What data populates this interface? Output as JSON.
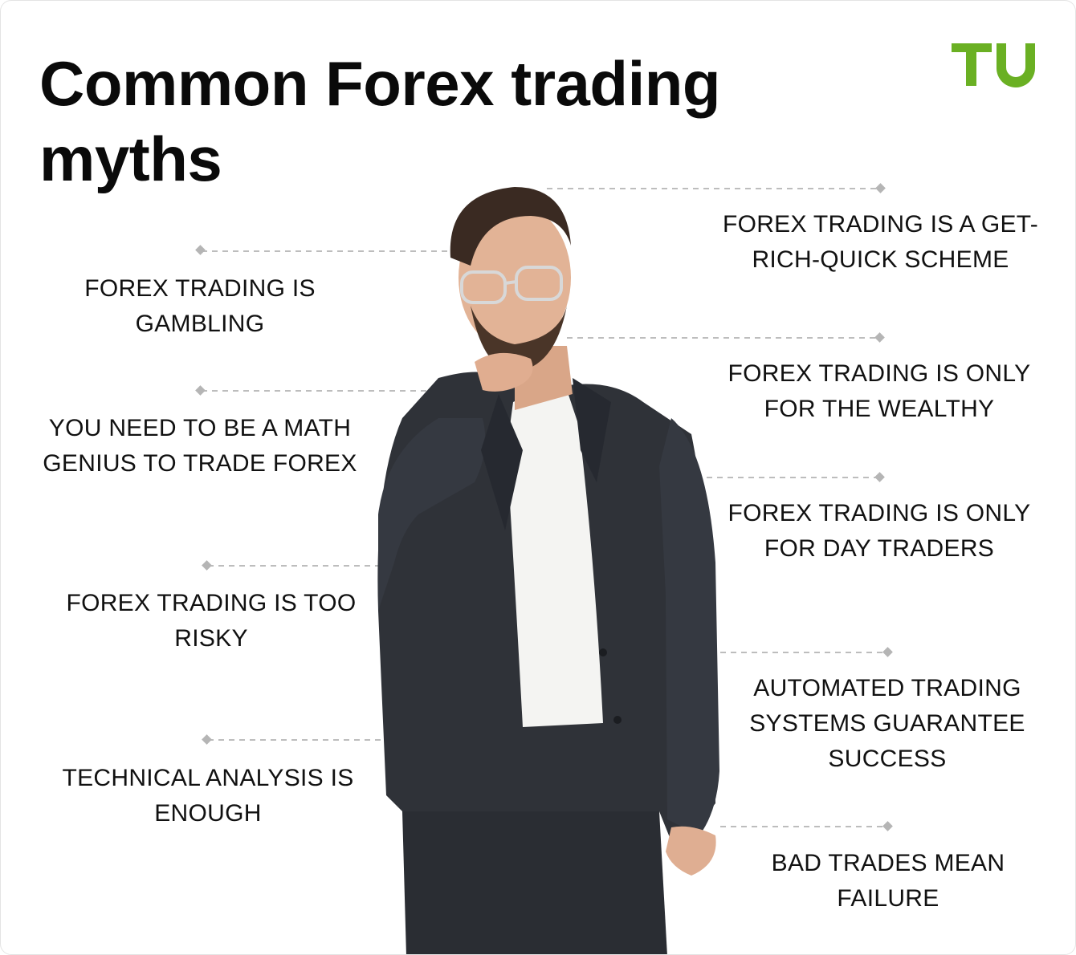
{
  "title": "Common Forex trading myths",
  "brand": {
    "logo_text": "TU",
    "logo_color": "#6ab023"
  },
  "myths": {
    "left": [
      "FOREX TRADING IS GAMBLING",
      "YOU NEED TO BE A MATH GENIUS TO TRADE FOREX",
      "FOREX TRADING IS TOO RISKY",
      "TECHNICAL ANALYSIS IS ENOUGH"
    ],
    "right": [
      "FOREX TRADING IS A GET-RICH-QUICK SCHEME",
      "FOREX TRADING IS ONLY FOR THE WEALTHY",
      "FOREX TRADING IS ONLY FOR DAY TRADERS",
      "AUTOMATED TRADING SYSTEMS GUARANTEE SUCCESS",
      "BAD TRADES MEAN FAILURE"
    ]
  },
  "image": {
    "subject": "man-in-suit-thinking-photo"
  },
  "colors": {
    "text": "#111111",
    "leader_line": "#bdbdbd",
    "suit": "#2f3238",
    "shirt": "#f4f4f2"
  }
}
